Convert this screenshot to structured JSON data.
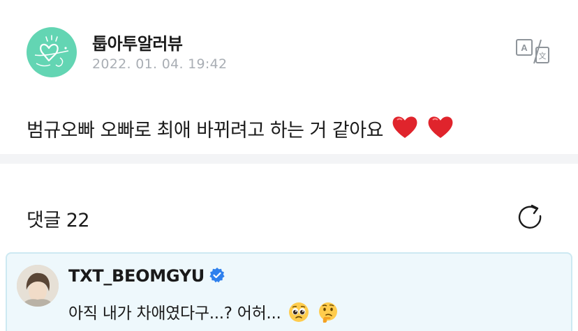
{
  "post": {
    "author": "툽아투알러뷰",
    "timestamp": "2022. 01. 04. 19:42",
    "body": "범규오빠 오빠로 최애 바뀌려고 하는 거 같아요",
    "translate_icon": "translate-icon"
  },
  "comments": {
    "label": "댓글",
    "count": "22",
    "refresh_icon": "refresh-icon"
  },
  "highlighted_comment": {
    "author": "TXT_BEOMGYU",
    "text": "아직 내가 차애였다구...? 어허...",
    "verified_color": "#2f80ed"
  },
  "colors": {
    "avatar_bg": "#63d5b3",
    "highlight_bg": "#eef8fc",
    "highlight_border": "#cde9f2",
    "heart": "#e0242c"
  }
}
